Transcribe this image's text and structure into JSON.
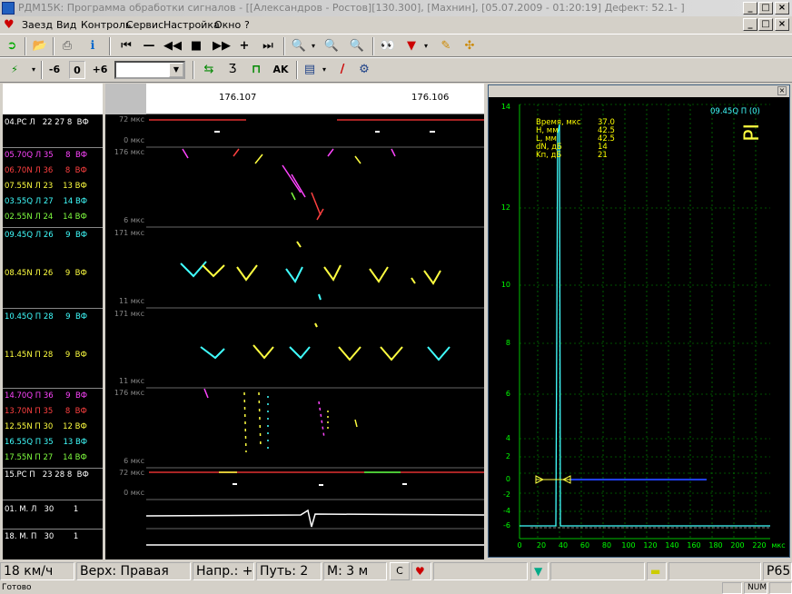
{
  "window": {
    "title": "РДМ15К: Программа обработки сигналов - [[Александров - Ростов][130.300], [Махнин], [05.07.2009 - 01:20:19] Дефект: 52.1- ]",
    "buttons": [
      "_",
      "□",
      "×"
    ],
    "doc_buttons": [
      "_",
      "□",
      "×"
    ]
  },
  "menu": [
    {
      "label": "Заезд"
    },
    {
      "label": "Вид"
    },
    {
      "label": "Контроль"
    },
    {
      "label": "Сервис"
    },
    {
      "label": "Настройка"
    },
    {
      "label": "Окно"
    },
    {
      "label": "?"
    }
  ],
  "toolbar2": {
    "minus6": "-6",
    "zero": "0",
    "plus6": "+6",
    "combo_value": "",
    "ak": "AK"
  },
  "channels": [
    {
      "label": "04.PC Л   22 27 8  ВФ",
      "color": "#ffffff"
    },
    {
      "label": "05.70Q Л 35     8  ВФ",
      "color": "#ff44ff"
    },
    {
      "label": "06.70N Л 36     8  ВФ",
      "color": "#ff4040"
    },
    {
      "label": "07.55N Л 23    13 ВФ",
      "color": "#ffff40"
    },
    {
      "label": "03.55Q Л 27    14 ВФ",
      "color": "#40ffff"
    },
    {
      "label": "02.55N Л 24    14 ВФ",
      "color": "#80ff40"
    },
    {
      "label": "09.45Q Л 26     9  ВФ",
      "color": "#40ffff"
    },
    {
      "label": "08.45N Л 26     9  ВФ",
      "color": "#ffff40"
    },
    {
      "label": "10.45Q П 28     9  ВФ",
      "color": "#40ffff"
    },
    {
      "label": "11.45N П 28     9  ВФ",
      "color": "#ffff40"
    },
    {
      "label": "14.70Q П 36     9  ВФ",
      "color": "#ff44ff"
    },
    {
      "label": "13.70N П 35     8  ВФ",
      "color": "#ff4040"
    },
    {
      "label": "12.55N П 30    12 ВФ",
      "color": "#ffff40"
    },
    {
      "label": "16.55Q П 35    13 ВФ",
      "color": "#40ffff"
    },
    {
      "label": "17.55N П 27    14 ВФ",
      "color": "#80ff40"
    },
    {
      "label": "15.PC П   23 28 8  ВФ",
      "color": "#ffffff"
    },
    {
      "label": "01. М. Л   30        1",
      "color": "#ffffff"
    },
    {
      "label": "18. М. П   30        1",
      "color": "#ffffff"
    }
  ],
  "scale_labels": [
    {
      "text": "72 мкс",
      "pos": "top"
    },
    {
      "text": "0 мкс",
      "pos": "bottom"
    },
    {
      "text": "176 мкс",
      "pos": "top"
    },
    {
      "text": "6 мкс",
      "pos": "bottom"
    },
    {
      "text": "171 мкс",
      "pos": "top"
    },
    {
      "text": "11 мкс",
      "pos": "bottom"
    },
    {
      "text": "171 мкс",
      "pos": "top"
    },
    {
      "text": "11 мкс",
      "pos": "bottom"
    },
    {
      "text": "176 мкс",
      "pos": "top"
    },
    {
      "text": "6 мкс",
      "pos": "bottom"
    },
    {
      "text": "72 мкс",
      "pos": "top"
    },
    {
      "text": "0 мкс",
      "pos": "bottom"
    }
  ],
  "coords": {
    "left": "176.107",
    "right": "176.106"
  },
  "ascan": {
    "channel_label": "09.45Q П (0)",
    "side_marker": "PI",
    "info": [
      {
        "k": "Время, мкс",
        "v": "37.0"
      },
      {
        "k": "H, мм",
        "v": "42.5"
      },
      {
        "k": "L, мм",
        "v": "42.5"
      },
      {
        "k": "dN, дБ",
        "v": "14"
      },
      {
        "k": "Kп, дБ",
        "v": "21"
      }
    ],
    "y_ticks": [
      "14",
      "12",
      "10",
      "8",
      "6",
      "4",
      "2",
      "0",
      "-2",
      "-4",
      "-6"
    ],
    "x_ticks": [
      "0",
      "20",
      "40",
      "60",
      "80",
      "100",
      "120",
      "140",
      "160",
      "180",
      "200",
      "220"
    ],
    "x_unit": "мкс",
    "colors": {
      "signal": "#40ffff",
      "gate": "#2040ff",
      "grid": "#00a000"
    }
  },
  "status": {
    "speed": "18 км/ч",
    "rail": "Верх: Правая",
    "dir": "Напр.: +",
    "track": "Путь: 2",
    "mark": "М: 3 м",
    "c_btn": "С",
    "right_code": "Р65"
  },
  "statusbar": {
    "ready": "Готово",
    "num": "NUM"
  }
}
